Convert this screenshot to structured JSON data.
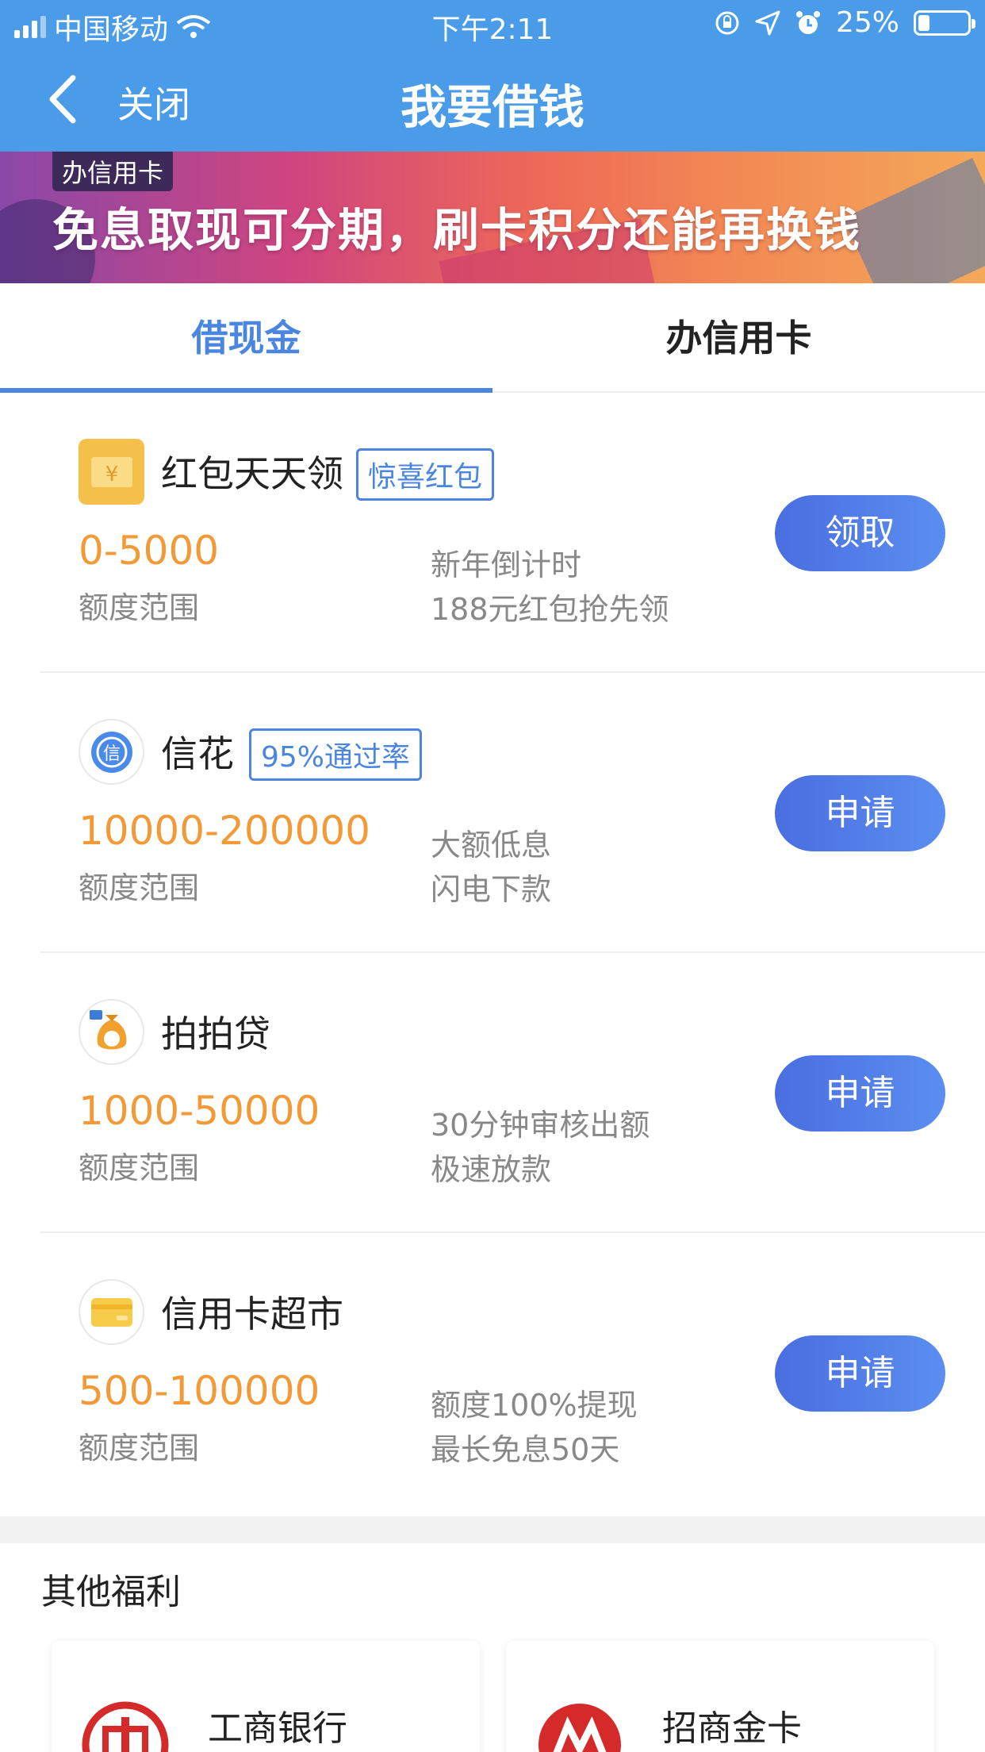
{
  "status_bar": {
    "carrier": "中国移动",
    "time": "下午2:11",
    "battery": "25%"
  },
  "nav": {
    "close_label": "关闭",
    "title": "我要借钱"
  },
  "banner": {
    "tag": "办信用卡",
    "text": "免息取现可分期，刷卡积分还能再换钱"
  },
  "tabs": [
    {
      "label": "借现金",
      "active": true
    },
    {
      "label": "办信用卡",
      "active": false
    }
  ],
  "loans": [
    {
      "name": "红包天天领",
      "tag": "惊喜红包",
      "range": "0-5000",
      "range_label": "额度范围",
      "desc1": "新年倒计时",
      "desc2": "188元红包抢先领",
      "button": "领取",
      "icon": "yen-icon"
    },
    {
      "name": "信花",
      "tag": "95%通过率",
      "range": "10000-200000",
      "range_label": "额度范围",
      "desc1": "大额低息",
      "desc2": "闪电下款",
      "button": "申请",
      "icon": "xin-icon"
    },
    {
      "name": "拍拍贷",
      "tag": "",
      "range": "1000-50000",
      "range_label": "额度范围",
      "desc1": "30分钟审核出额",
      "desc2": "极速放款",
      "button": "申请",
      "icon": "money-bag-icon"
    },
    {
      "name": "信用卡超市",
      "tag": "",
      "range": "500-100000",
      "range_label": "额度范围",
      "desc1": "额度100%提现",
      "desc2": "最长免息50天",
      "button": "申请",
      "icon": "card-icon"
    }
  ],
  "welfare": {
    "title": "其他福利",
    "cards": [
      {
        "label": "工商银行",
        "icon": "icbc-logo-icon"
      },
      {
        "label": "招商金卡",
        "icon": "cmb-logo-icon"
      }
    ]
  },
  "colors": {
    "header": "#4a9be8",
    "accent": "#4a86e0",
    "range": "#f39a38"
  }
}
